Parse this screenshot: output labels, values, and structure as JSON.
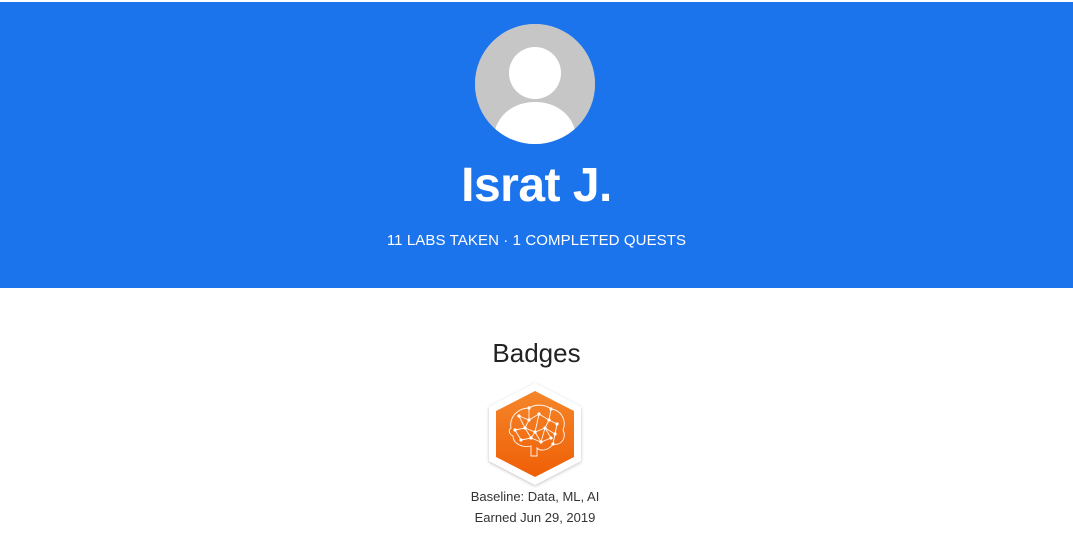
{
  "profile": {
    "name": "Israt J.",
    "stats": "11 LABS TAKEN · 1 COMPLETED QUESTS",
    "avatar_icon": "default-avatar-icon"
  },
  "badges": {
    "title": "Badges",
    "items": [
      {
        "name": "Baseline: Data, ML, AI",
        "earned": "Earned Jun 29, 2019",
        "icon": "brain-network-icon"
      }
    ]
  },
  "colors": {
    "hero_background": "#1c74ec",
    "badge_orange": "#f26a0a",
    "avatar_gray": "#c6c6c6"
  }
}
